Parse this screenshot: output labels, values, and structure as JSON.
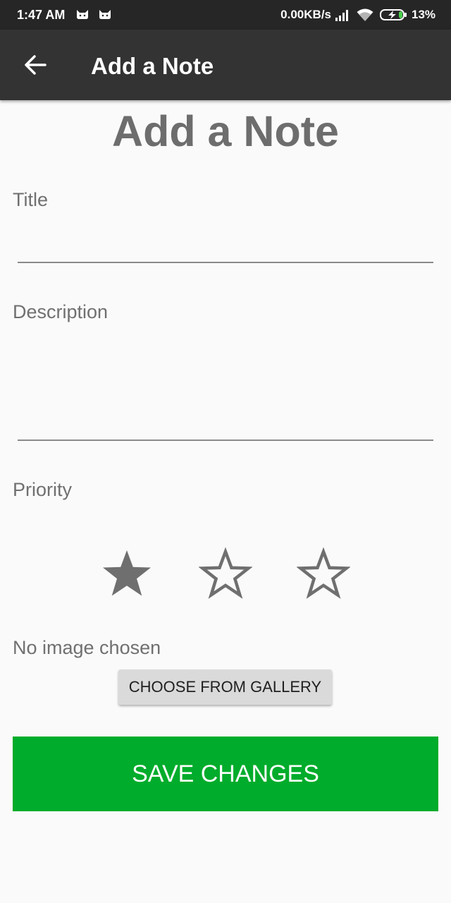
{
  "status_bar": {
    "time": "1:47 AM",
    "network_speed": "0.00KB/s",
    "battery_percent": "13%",
    "icons": [
      "android-cat-icon",
      "android-cat-icon",
      "signal-icon",
      "wifi-icon",
      "battery-charging-icon"
    ]
  },
  "app_bar": {
    "title": "Add a Note",
    "back_icon": "arrow-back-icon"
  },
  "form": {
    "heading": "Add a Note",
    "title_label": "Title",
    "title_value": "",
    "description_label": "Description",
    "description_value": "",
    "priority_label": "Priority",
    "priority": {
      "value": 1,
      "max": 3
    },
    "no_image_text": "No image chosen",
    "gallery_button": "CHOOSE FROM GALLERY",
    "save_button": "SAVE CHANGES"
  },
  "colors": {
    "status_bar": "#262626",
    "app_bar": "#333333",
    "background": "#fafafa",
    "text_gray": "#707070",
    "star": "#6f6f6f",
    "save_button": "#00ac2b",
    "gallery_button": "#dadada"
  }
}
